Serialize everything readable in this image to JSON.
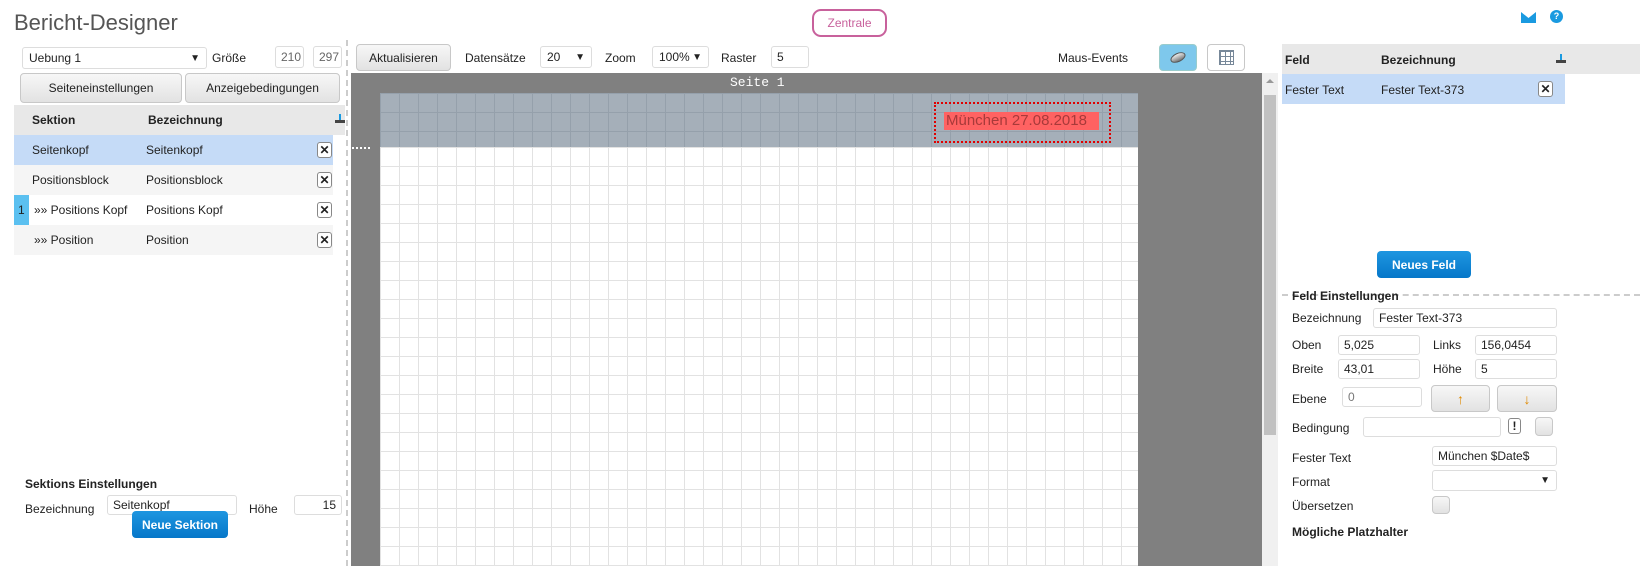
{
  "app": {
    "title": "Bericht-Designer",
    "zentrale": "Zentrale"
  },
  "left": {
    "report_select": "Uebung 1",
    "size_label": "Größe",
    "size_w": "210",
    "size_h": "297",
    "page_settings": "Seiteneinstellungen",
    "display_conditions": "Anzeigebedingungen",
    "table": {
      "col_section": "Sektion",
      "col_name": "Bezeichnung",
      "rows": [
        {
          "num": "",
          "section": "Seitenkopf",
          "name": "Seitenkopf"
        },
        {
          "num": "",
          "section": "Positionsblock",
          "name": "Positionsblock"
        },
        {
          "num": "1",
          "section": "»» Positions Kopf",
          "name": "Positions Kopf"
        },
        {
          "num": "",
          "section": "»» Position",
          "name": "Position"
        }
      ]
    },
    "section_settings": {
      "title": "Sektions Einstellungen",
      "name_label": "Bezeichnung",
      "name_value": "Seitenkopf",
      "height_label": "Höhe",
      "height_value": "15"
    },
    "new_section": "Neue Sektion"
  },
  "toolbar": {
    "refresh": "Aktualisieren",
    "records_label": "Datensätze",
    "records_value": "20",
    "zoom_label": "Zoom",
    "zoom_value": "100%",
    "grid_label": "Raster",
    "grid_value": "5",
    "mouse_events": "Maus-Events"
  },
  "canvas": {
    "page_label": "Seite 1",
    "field_text": "München 27.08.2018"
  },
  "right": {
    "table": {
      "col_field": "Feld",
      "col_name": "Bezeichnung",
      "rows": [
        {
          "field": "Fester Text",
          "name": "Fester Text-373"
        }
      ]
    },
    "new_field": "Neues Feld",
    "settings": {
      "title": "Feld Einstellungen",
      "name_label": "Bezeichnung",
      "name_value": "Fester Text-373",
      "top_label": "Oben",
      "top_value": "5,025",
      "left_label": "Links",
      "left_value": "156,0454",
      "width_label": "Breite",
      "width_value": "43,01",
      "height_label": "Höhe",
      "height_value": "5",
      "layer_label": "Ebene",
      "layer_value": "0",
      "up": "↑",
      "down": "↓",
      "condition_label": "Bedingung",
      "condition_value": "",
      "excl": "!",
      "fixed_text_label": "Fester Text",
      "fixed_text_value": "München $Date$",
      "format_label": "Format",
      "format_value": "",
      "translate_label": "Übersetzen",
      "placeholders_title": "Mögliche Platzhalter"
    }
  },
  "colors": {
    "accent": "#0a7fd0",
    "selected_row": "#c5dbf7",
    "zentrale": "#c8619c",
    "field": "#ff6262"
  }
}
